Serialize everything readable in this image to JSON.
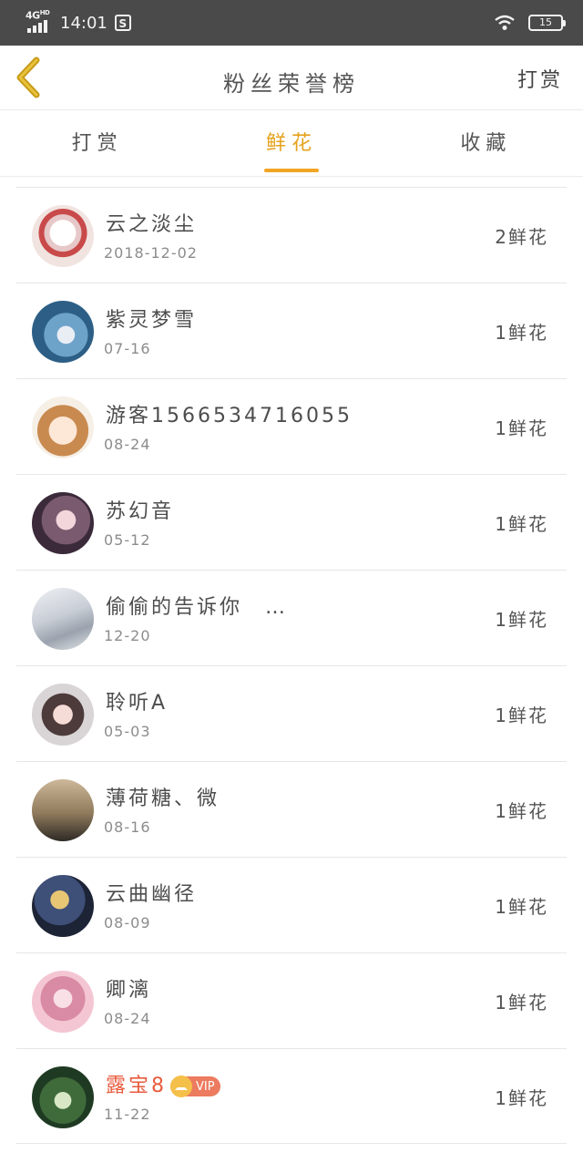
{
  "status_bar": {
    "network": "4G",
    "network_sup": "HD",
    "time": "14:01",
    "app_icon": "S",
    "battery": "15"
  },
  "header": {
    "title": "粉丝荣誉榜",
    "right_action": "打赏",
    "back_icon": "chevron-left-icon"
  },
  "tabs": [
    {
      "label": "打赏",
      "active": false
    },
    {
      "label": "鲜花",
      "active": true
    },
    {
      "label": "收藏",
      "active": false
    }
  ],
  "colors": {
    "accent": "#e5a21c",
    "status_bar": "#4a4a4a",
    "vip_name": "#e85a3c"
  },
  "rows": [
    {
      "name": "云之淡尘",
      "date": "2018-12-02",
      "count": "2鲜花"
    },
    {
      "name": "紫灵梦雪",
      "date": "07-16",
      "count": "1鲜花"
    },
    {
      "name": "游客1566534716055",
      "date": "08-24",
      "count": "1鲜花"
    },
    {
      "name": "苏幻音",
      "date": "05-12",
      "count": "1鲜花"
    },
    {
      "name": "偷偷的告诉你　…",
      "date": "12-20",
      "count": "1鲜花"
    },
    {
      "name": "聆听A",
      "date": "05-03",
      "count": "1鲜花"
    },
    {
      "name": "薄荷糖、微",
      "date": "08-16",
      "count": "1鲜花"
    },
    {
      "name": "云曲幽径",
      "date": "08-09",
      "count": "1鲜花"
    },
    {
      "name": "卿漓",
      "date": "08-24",
      "count": "1鲜花"
    },
    {
      "name": "露宝8",
      "date": "11-22",
      "count": "1鲜花",
      "vip": "VIP"
    }
  ]
}
